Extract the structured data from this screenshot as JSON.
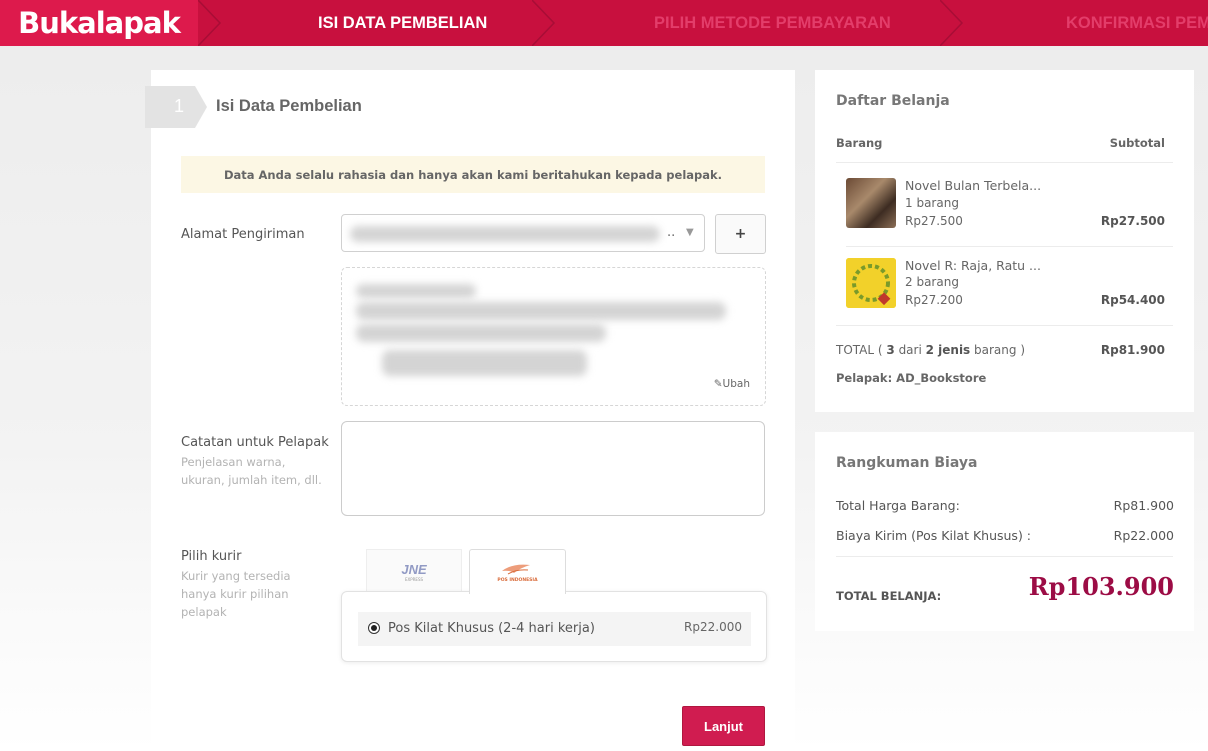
{
  "header": {
    "logo": "Bukalapak",
    "steps": [
      {
        "label": "ISI DATA PEMBELIAN",
        "active": true
      },
      {
        "label": "PILIH METODE PEMBAYARAN",
        "active": false
      },
      {
        "label": "KONFIRMASI PEMBE",
        "active": false
      }
    ]
  },
  "form": {
    "step_number": "1",
    "title": "Isi Data Pembelian",
    "notice": "Data Anda selalu rahasia dan hanya akan kami beritahukan kepada pelapak.",
    "address_label": "Alamat Pengiriman",
    "address_select_suffix": "..",
    "add_button": "+",
    "edit_link": "Ubah",
    "note_label": "Catatan untuk Pelapak",
    "note_help": "Penjelasan warna, ukuran, jumlah item, dll.",
    "courier_label": "Pilih kurir",
    "courier_help": "Kurir yang tersedia hanya kurir pilihan pelapak",
    "courier_tabs": [
      {
        "logo": "JNE",
        "sub": "EXPRESS",
        "active": false
      },
      {
        "logo": "POS INDONESIA",
        "active": true
      }
    ],
    "courier_option": {
      "name": "Pos Kilat Khusus (2-4 hari kerja)",
      "price": "Rp22.000",
      "selected": true
    },
    "next_button": "Lanjut"
  },
  "cart": {
    "title": "Daftar Belanja",
    "col_item": "Barang",
    "col_subtotal": "Subtotal",
    "items": [
      {
        "name": "Novel Bulan Terbela...",
        "qty": "1 barang",
        "price": "Rp27.500",
        "subtotal": "Rp27.500"
      },
      {
        "name": "Novel R: Raja, Ratu ...",
        "qty": "2 barang",
        "price": "Rp27.200",
        "subtotal": "Rp54.400"
      }
    ],
    "total_prefix": "TOTAL ( ",
    "total_qty": "3",
    "total_mid": " dari ",
    "total_kinds": "2 jenis",
    "total_suffix": " barang )",
    "total_value": "Rp81.900",
    "seller": "Pelapak: AD_Bookstore"
  },
  "summary": {
    "title": "Rangkuman Biaya",
    "rows": [
      {
        "label": "Total Harga Barang:",
        "value": "Rp81.900"
      },
      {
        "label": "Biaya Kirim (Pos Kilat Khusus) :",
        "value": "Rp22.000"
      }
    ],
    "grand_label": "TOTAL BELANJA:",
    "grand_value": "Rp103.900"
  },
  "colors": {
    "brand": "#c8103e",
    "accent": "#d01c50",
    "grand_total": "#9c0c45"
  }
}
